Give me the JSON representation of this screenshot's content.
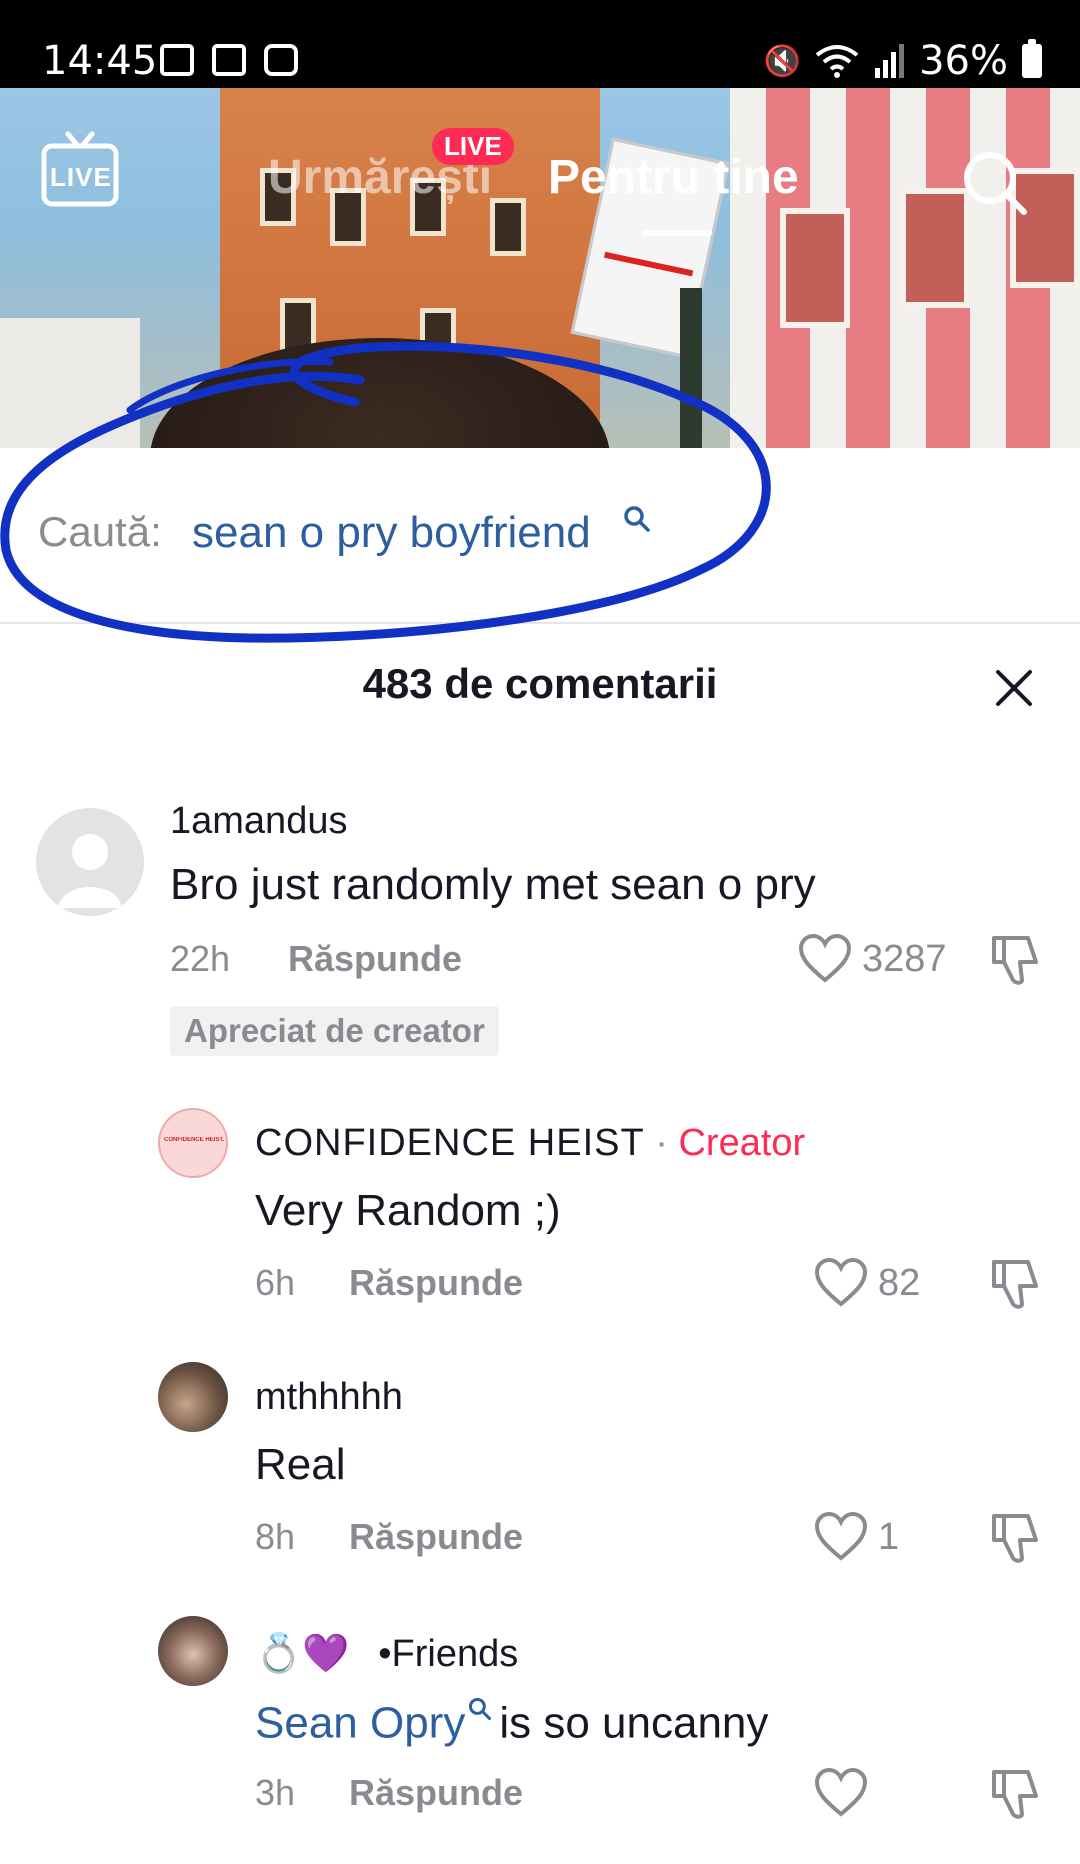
{
  "status_bar": {
    "time": "14:45",
    "battery": "36%",
    "icons": [
      "notification-icon",
      "gallery-icon",
      "screen-record-icon",
      "mute-icon",
      "wifi-icon",
      "signal-icon",
      "battery-icon"
    ]
  },
  "top_nav": {
    "live_button_label": "LIVE",
    "live_badge": "LIVE",
    "tabs": [
      {
        "label": "Urmărești",
        "active": false
      },
      {
        "label": "Pentru tine",
        "active": true
      }
    ]
  },
  "search_suggestion": {
    "prefix": "Caută:",
    "query": "sean o pry boyfriend"
  },
  "annotation_color": "#1131c4",
  "comments_header": {
    "title": "483 de comentarii"
  },
  "comments": [
    {
      "username": "1amandus",
      "text": "Bro just randomly met sean o pry",
      "time": "22h",
      "reply_label": "Răspunde",
      "likes": "3287",
      "badge": "Apreciat de creator"
    },
    {
      "username": "CONFIDENCE HEIST",
      "separator": "·",
      "role": "Creator",
      "avatar_text": "CONFIDENCE HEIST.",
      "text": "Very Random ;)",
      "time": "6h",
      "reply_label": "Răspunde",
      "likes": "82"
    },
    {
      "username": "mthhhhh",
      "text": "Real",
      "time": "8h",
      "reply_label": "Răspunde",
      "likes": "1"
    },
    {
      "username_emoji": "💍💜",
      "username": "•Friends",
      "text_link": "Sean Opry",
      "text": "is so uncanny",
      "time": "3h",
      "reply_label": "Răspunde",
      "likes": ""
    }
  ],
  "colors": {
    "accent_red": "#fe2c55",
    "link_blue": "#2c5ea0",
    "muted_gray": "#8a8b91"
  }
}
